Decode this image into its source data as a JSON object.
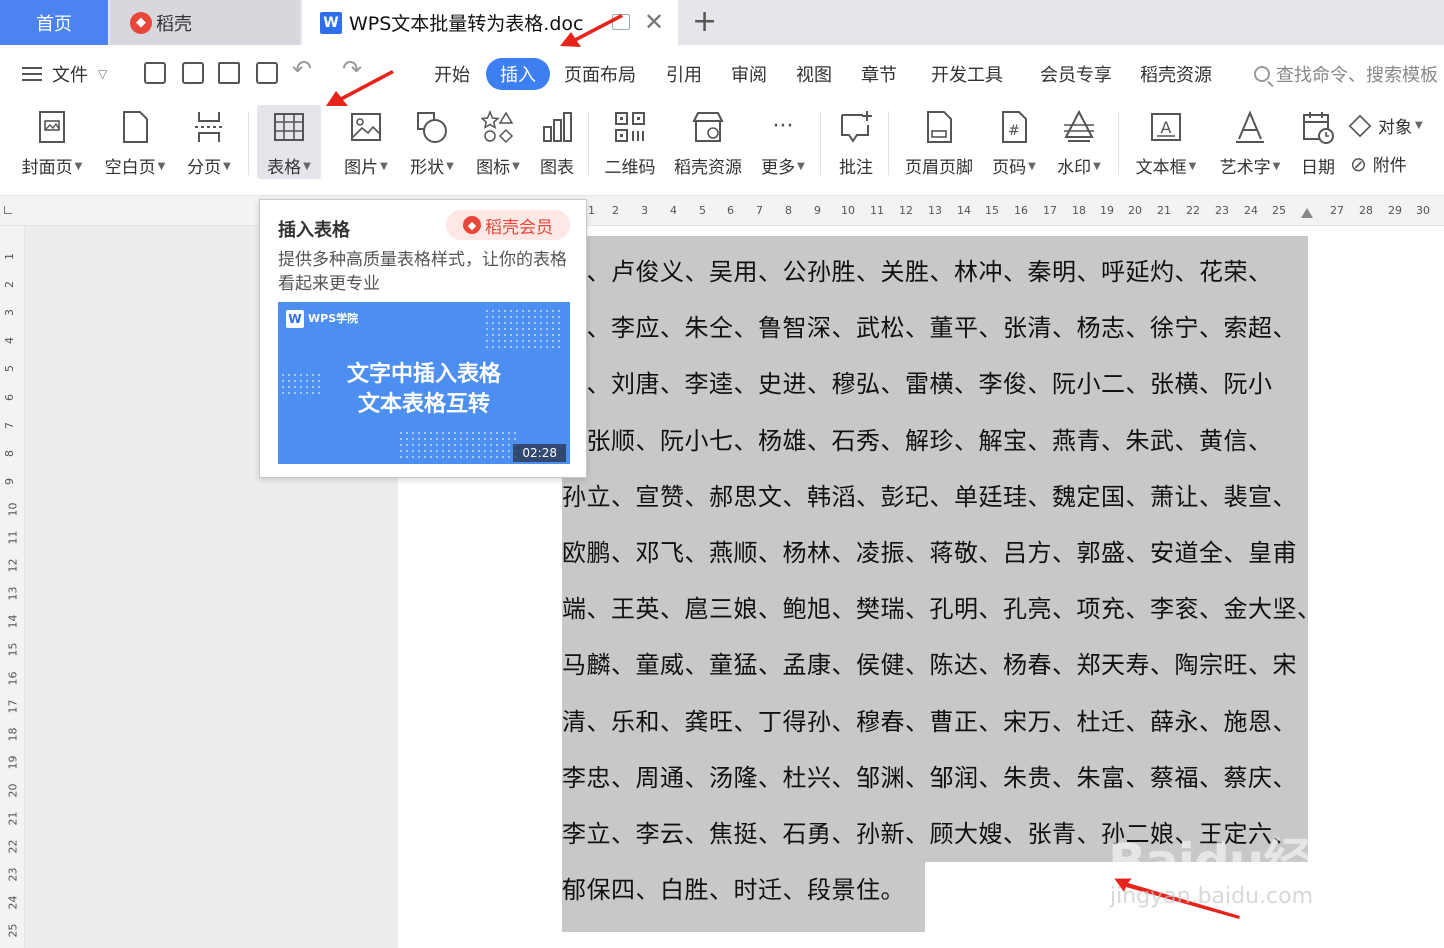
{
  "tabs": {
    "home": "首页",
    "straw": "稻壳",
    "document": "WPS文本批量转为表格.doc",
    "close": "✕",
    "new_tab": "+"
  },
  "menu": {
    "file": "文件",
    "tabs": [
      "开始",
      "插入",
      "页面布局",
      "引用",
      "审阅",
      "视图",
      "章节",
      "开发工具",
      "会员专享",
      "稻壳资源"
    ],
    "active_tab": "插入",
    "search_placeholder": "查找命令、搜索模板"
  },
  "ribbon": {
    "cover": "封面页",
    "blank": "空白页",
    "page_break": "分页",
    "table": "表格",
    "picture": "图片",
    "shape": "形状",
    "icon": "图标",
    "chart": "图表",
    "qrcode": "二维码",
    "straw_resource": "稻壳资源",
    "more": "更多",
    "comment": "批注",
    "header_footer": "页眉页脚",
    "page_number": "页码",
    "watermark": "水印",
    "textbox": "文本框",
    "wordart": "艺术字",
    "date": "日期",
    "object": "对象",
    "attachment": "附件"
  },
  "tooltip": {
    "title": "插入表格",
    "badge": "稻壳会员",
    "description": "提供多种高质量表格样式，让你的表格看起来更专业",
    "video": {
      "brand": "WPS学院",
      "line1": "文字中插入表格",
      "line2": "文本表格互转",
      "duration": "02:28"
    }
  },
  "ruler": {
    "horizontal": [
      "1",
      "2",
      "3",
      "4",
      "5",
      "6",
      "7",
      "8",
      "9",
      "10",
      "11",
      "12",
      "13",
      "14",
      "15",
      "16",
      "17",
      "18",
      "19",
      "20",
      "21",
      "22",
      "23",
      "24",
      "25",
      "27",
      "28",
      "29",
      "30"
    ],
    "vertical": [
      "1",
      "2",
      "3",
      "4",
      "5",
      "6",
      "7",
      "8",
      "9",
      "10",
      "11",
      "12",
      "13",
      "14",
      "15",
      "16",
      "17",
      "18",
      "19",
      "20",
      "21",
      "22",
      "23",
      "24",
      "25"
    ]
  },
  "document": {
    "lines": [
      "江、卢俊义、吴用、公孙胜、关胜、林冲、秦明、呼延灼、花荣、",
      "进、李应、朱仝、鲁智深、武松、董平、张清、杨志、徐宁、索超、",
      "宗、刘唐、李逵、史进、穆弘、雷横、李俊、阮小二、张横、阮小",
      "、张顺、阮小七、杨雄、石秀、解珍、解宝、燕青、朱武、黄信、",
      "孙立、宣赞、郝思文、韩滔、彭玘、单廷珪、魏定国、萧让、裴宣、",
      "欧鹏、邓飞、燕顺、杨林、凌振、蒋敬、吕方、郭盛、安道全、皇甫",
      "端、王英、扈三娘、鲍旭、樊瑞、孔明、孔亮、项充、李衮、金大坚、",
      "马麟、童威、童猛、孟康、侯健、陈达、杨春、郑天寿、陶宗旺、宋",
      "清、乐和、龚旺、丁得孙、穆春、曹正、宋万、杜迁、薛永、施恩、",
      "李忠、周通、汤隆、杜兴、邹渊、邹润、朱贵、朱富、蔡福、蔡庆、",
      "李立、李云、焦挺、石勇、孙新、顾大嫂、张青、孙二娘、王定六、",
      "郁保四、白胜、时迁、段景住。"
    ]
  },
  "watermark": {
    "text": "Baidu经验",
    "url_text": "jingyan.baidu.com"
  },
  "colors": {
    "accent": "#3d7ef0",
    "home_tab": "#4b84f1",
    "annotation_arrow": "#e8231c",
    "selection": "#c8c8c8",
    "member_badge": "#e8473a"
  }
}
